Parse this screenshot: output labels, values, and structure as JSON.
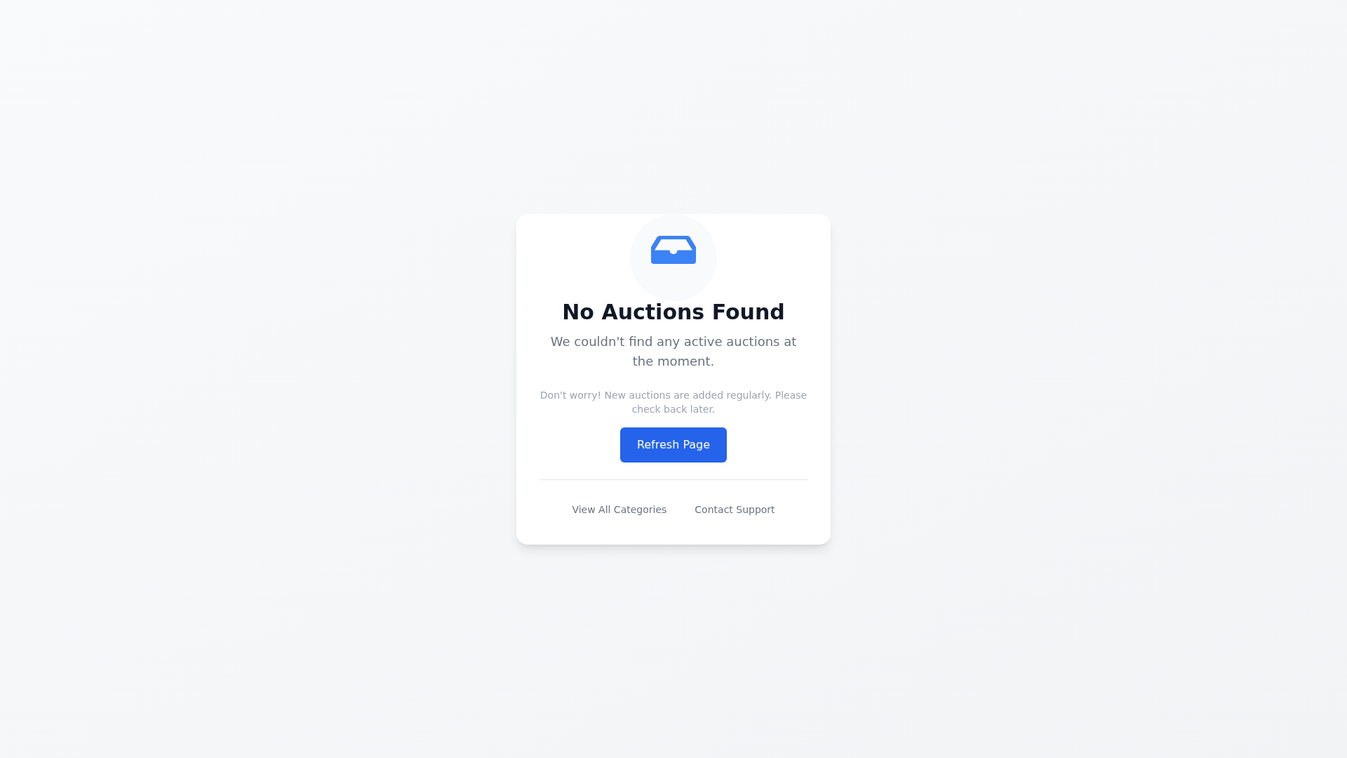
{
  "empty_state": {
    "title": "No Auctions Found",
    "message": "We couldn't find any active auctions at the moment.",
    "note": "Don't worry! New auctions are added regularly. Please check back later.",
    "button": "Refresh Page",
    "links": [
      "View All Categories",
      "Contact Support"
    ]
  }
}
